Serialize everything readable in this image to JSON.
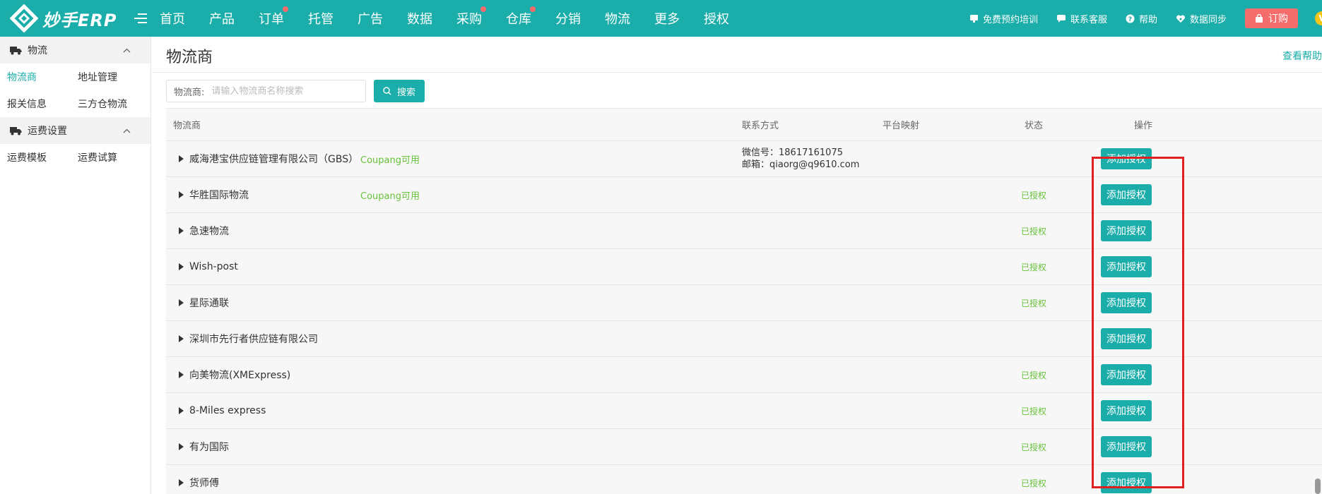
{
  "app": {
    "logo_text": "妙手ERP",
    "nav": [
      {
        "label": "首页",
        "dot": false
      },
      {
        "label": "产品",
        "dot": false
      },
      {
        "label": "订单",
        "dot": true
      },
      {
        "label": "托管",
        "dot": false
      },
      {
        "label": "广告",
        "dot": false
      },
      {
        "label": "数据",
        "dot": false
      },
      {
        "label": "采购",
        "dot": true
      },
      {
        "label": "仓库",
        "dot": true
      },
      {
        "label": "分销",
        "dot": false
      },
      {
        "label": "物流",
        "dot": false
      },
      {
        "label": "更多",
        "dot": false
      },
      {
        "label": "授权",
        "dot": false
      }
    ],
    "top_right": {
      "training": "免费预约培训",
      "service": "联系客服",
      "help": "帮助",
      "sync": "数据同步",
      "order": "订购",
      "vip": "V"
    }
  },
  "sidebar": {
    "group1_title": "物流",
    "group1_links": [
      "物流商",
      "地址管理",
      "报关信息",
      "三方仓物流"
    ],
    "group2_title": "运费设置",
    "group2_links": [
      "运费模板",
      "运费试算"
    ]
  },
  "main": {
    "title": "物流商",
    "help_link": "查看帮助",
    "search": {
      "label": "物流商:",
      "placeholder": "请输入物流商名称搜索",
      "value": "",
      "button": "搜索"
    },
    "columns": [
      "物流商",
      "联系方式",
      "平台映射",
      "状态",
      "操作"
    ],
    "rows": [
      {
        "name": "威海港宝供应链管理有限公司（GBS）",
        "tag": "Coupang可用",
        "wechat": "微信号：18617161075",
        "email": "邮箱：qiaorg@q9610.com",
        "status": "",
        "action": "添加授权"
      },
      {
        "name": "华胜国际物流",
        "tag": "Coupang可用",
        "wechat": "",
        "email": "",
        "status": "已授权",
        "action": "添加授权"
      },
      {
        "name": "急速物流",
        "tag": "",
        "wechat": "",
        "email": "",
        "status": "已授权",
        "action": "添加授权"
      },
      {
        "name": "Wish-post",
        "tag": "",
        "wechat": "",
        "email": "",
        "status": "已授权",
        "action": "添加授权"
      },
      {
        "name": "星际通联",
        "tag": "",
        "wechat": "",
        "email": "",
        "status": "已授权",
        "action": "添加授权"
      },
      {
        "name": "深圳市先行者供应链有限公司",
        "tag": "",
        "wechat": "",
        "email": "",
        "status": "",
        "action": "添加授权"
      },
      {
        "name": "向美物流(XMExpress)",
        "tag": "",
        "wechat": "",
        "email": "",
        "status": "已授权",
        "action": "添加授权"
      },
      {
        "name": "8-Miles express",
        "tag": "",
        "wechat": "",
        "email": "",
        "status": "已授权",
        "action": "添加授权"
      },
      {
        "name": "有为国际",
        "tag": "",
        "wechat": "",
        "email": "",
        "status": "已授权",
        "action": "添加授权"
      },
      {
        "name": "货师傅",
        "tag": "",
        "wechat": "",
        "email": "",
        "status": "已授权",
        "action": "添加授权"
      }
    ]
  },
  "colors": {
    "brand": "#1aadaa",
    "ok": "#67c23a",
    "order": "#f56c6c",
    "highlight": "#e02020"
  }
}
